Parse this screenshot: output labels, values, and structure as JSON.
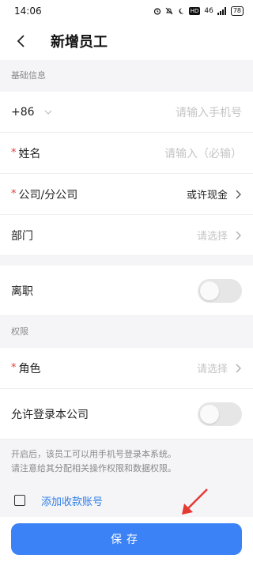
{
  "status_bar": {
    "time": "14:06",
    "hd": "HD",
    "signal": "46",
    "battery": "78"
  },
  "nav": {
    "title": "新增员工"
  },
  "basic_section": {
    "header": "基础信息",
    "phone": {
      "prefix": "+86",
      "placeholder": "请输入手机号"
    },
    "name": {
      "label": "姓名",
      "placeholder": "请输入（必输）"
    },
    "company": {
      "label": "公司/分公司",
      "value": "或许现金"
    },
    "department": {
      "label": "部门",
      "placeholder": "请选择"
    }
  },
  "resign": {
    "label": "离职",
    "enabled": false
  },
  "permission_section": {
    "header": "权限",
    "role": {
      "label": "角色",
      "placeholder": "请选择"
    },
    "allow_login": {
      "label": "允许登录本公司",
      "enabled": false
    },
    "hint_line1": "开启后，该员工可以用手机号登录本系统。",
    "hint_line2": "请注意给其分配相关操作权限和数据权限。"
  },
  "payment": {
    "add_account_label": "添加收款账号",
    "checked": false
  },
  "footer": {
    "save_label": "保存"
  },
  "colors": {
    "primary": "#3b82f6",
    "link": "#2d7ee8",
    "required": "#e53935",
    "annotation_arrow": "#e53935"
  }
}
